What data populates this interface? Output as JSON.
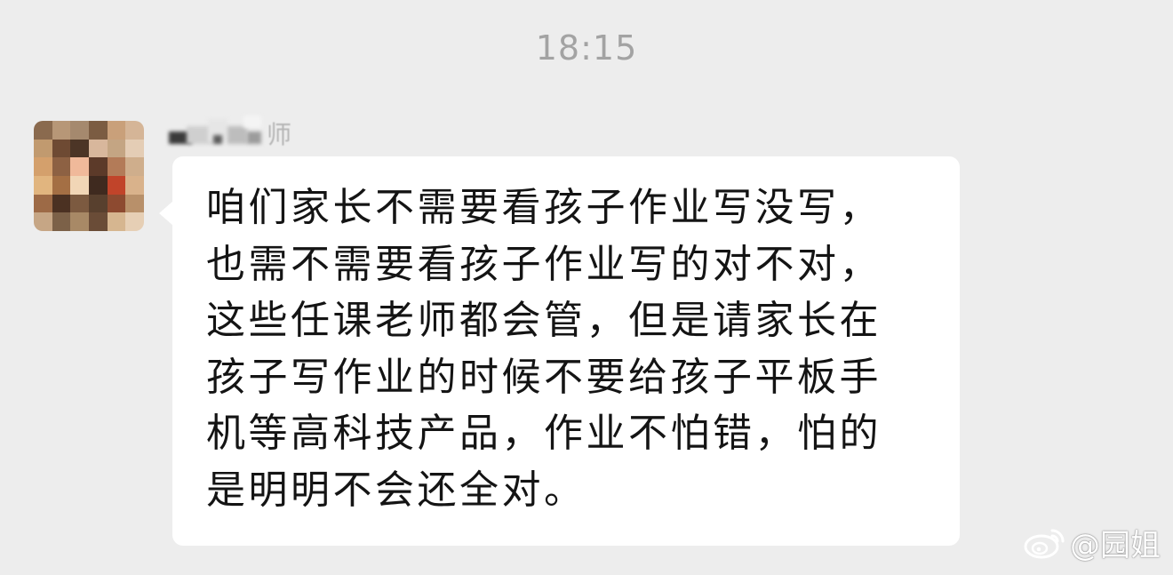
{
  "chat": {
    "timestamp": "18:15",
    "message": {
      "sender_name_visible": "师",
      "text": "咱们家长不需要看孩子作业写没写，\n也需不需要看孩子作业写的对不对，\n这些任课老师都会管，但是请家长在\n孩子写作业的时候不要给孩子平板手\n机等高科技产品，作业不怕错，怕的\n是明明不会还全对。"
    }
  },
  "watermark": {
    "icon": "weibo-icon",
    "text": "@园姐"
  },
  "colors": {
    "background": "#ededed",
    "bubble": "#ffffff",
    "text": "#141414",
    "timestamp": "#a3a3a3"
  }
}
